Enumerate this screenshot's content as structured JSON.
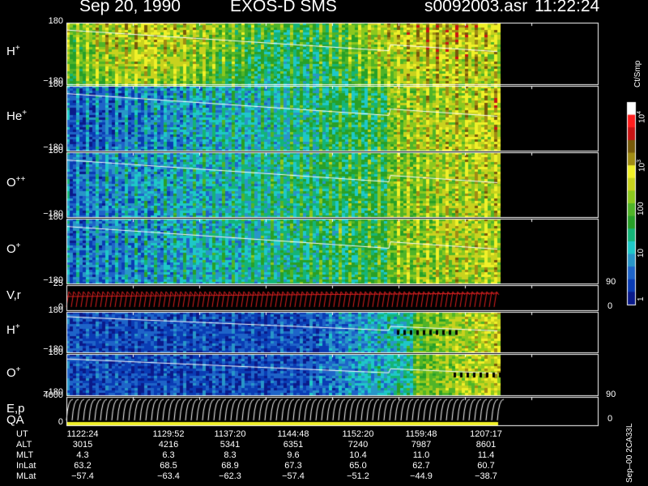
{
  "header": {
    "date": "Sep 20, 1990",
    "instrument": "EXOS-D SMS",
    "file": "s0092003.asr",
    "time": "11:22:24"
  },
  "colorbar": {
    "title": "Ct/Smp",
    "labels": [
      "1",
      "10",
      "100",
      "10",
      "10"
    ],
    "exponents": [
      "",
      "",
      "",
      "3",
      "4"
    ],
    "colors": [
      "#0a1a8a",
      "#0a3cb4",
      "#1e64c8",
      "#2896c8",
      "#1ec8c8",
      "#14b478",
      "#28a028",
      "#50b428",
      "#8cc81e",
      "#c8d21e",
      "#f0f028",
      "#a08c14",
      "#785a0a",
      "#c81414",
      "#ff1e1e",
      "#ffffff"
    ]
  },
  "panels": [
    {
      "label": "H",
      "sup": "+",
      "top_tick": "180",
      "bottom_tick": "−180"
    },
    {
      "label": "He",
      "sup": "+",
      "top_tick": "180",
      "bottom_tick": "−180"
    },
    {
      "label": "O",
      "sup": "++",
      "top_tick": "180",
      "bottom_tick": "−180"
    },
    {
      "label": "O",
      "sup": "+",
      "top_tick": "180",
      "bottom_tick": "−180"
    },
    {
      "label": "V,r",
      "sup": "",
      "top_tick": "25",
      "bottom_tick": "0"
    },
    {
      "label": "H",
      "sup": "+",
      "top_tick": "180",
      "bottom_tick": "−180"
    },
    {
      "label": "O",
      "sup": "+",
      "top_tick": "180",
      "bottom_tick": "−180"
    },
    {
      "label": "E,p",
      "sup": "",
      "top_tick": "4000",
      "bottom_tick": "0"
    }
  ],
  "qa_label": "QA",
  "right_ticks": {
    "vr_top": "90",
    "vr_bottom": "0",
    "ep_top": "90",
    "ep_bottom": "0"
  },
  "table": {
    "rows": [
      {
        "name": "UT",
        "values": [
          "1122:24",
          "1129:52",
          "1137:20",
          "1144:48",
          "1152:20",
          "1159:48",
          "1207:17"
        ]
      },
      {
        "name": "ALT",
        "values": [
          "3015",
          "4216",
          "5341",
          "6351",
          "7240",
          "7987",
          "8601"
        ]
      },
      {
        "name": "MLT",
        "values": [
          "4.3",
          "6.3",
          "8.3",
          "9.6",
          "10.4",
          "11.0",
          "11.4"
        ]
      },
      {
        "name": "InLat",
        "values": [
          "63.2",
          "68.5",
          "68.9",
          "67.3",
          "65.0",
          "62.7",
          "60.7"
        ]
      },
      {
        "name": "MLat",
        "values": [
          "−57.4",
          "−63.4",
          "−62.3",
          "−57.4",
          "−51.2",
          "−44.9",
          "−38.7"
        ]
      }
    ]
  },
  "footer": "Sep–00 2CA33L",
  "chart_data": {
    "type": "heatmap",
    "title": "Sep 20, 1990   EXOS-D SMS",
    "x_axis": "UT",
    "x_ticks": [
      "1122:24",
      "1129:52",
      "1137:20",
      "1144:48",
      "1152:20",
      "1159:48",
      "1207:17"
    ],
    "panels": [
      "H+",
      "He+",
      "O++",
      "O+",
      "V,r",
      "H+",
      "O+",
      "E,p"
    ],
    "ylim_angle": [
      -180,
      180
    ],
    "color_scale": "log",
    "color_range": [
      1,
      10000
    ],
    "colorbar_label": "Ct/Smp"
  }
}
